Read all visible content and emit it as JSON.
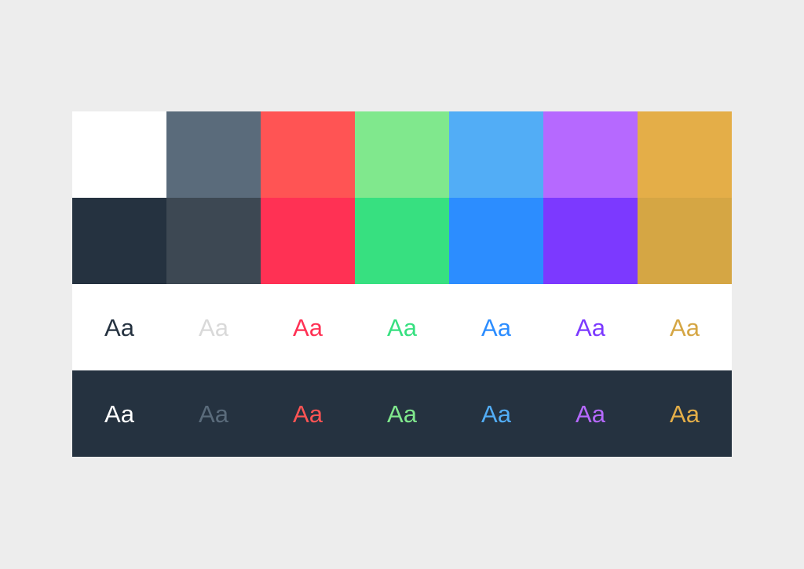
{
  "palette": {
    "light_swatches": [
      "#FFFFFF",
      "#5A6B7B",
      "#FF5454",
      "#80E88D",
      "#52ADF6",
      "#B669FF",
      "#E4AE48"
    ],
    "dark_swatches": [
      "#253240",
      "#3D4853",
      "#FF3154",
      "#37E080",
      "#2C8DFF",
      "#7C39FF",
      "#D5A644"
    ],
    "light_text_row": {
      "background": "#FFFFFF",
      "sample_text": "Aa",
      "text_colors": [
        "#253240",
        "#D9D9D9",
        "#FF3154",
        "#37E080",
        "#2C8DFF",
        "#7C39FF",
        "#D5A644"
      ]
    },
    "dark_text_row": {
      "background": "#253240",
      "sample_text": "Aa",
      "text_colors": [
        "#FFFFFF",
        "#5A6B7B",
        "#FF5454",
        "#80E88D",
        "#52ADF6",
        "#B669FF",
        "#E4AE48"
      ]
    }
  }
}
